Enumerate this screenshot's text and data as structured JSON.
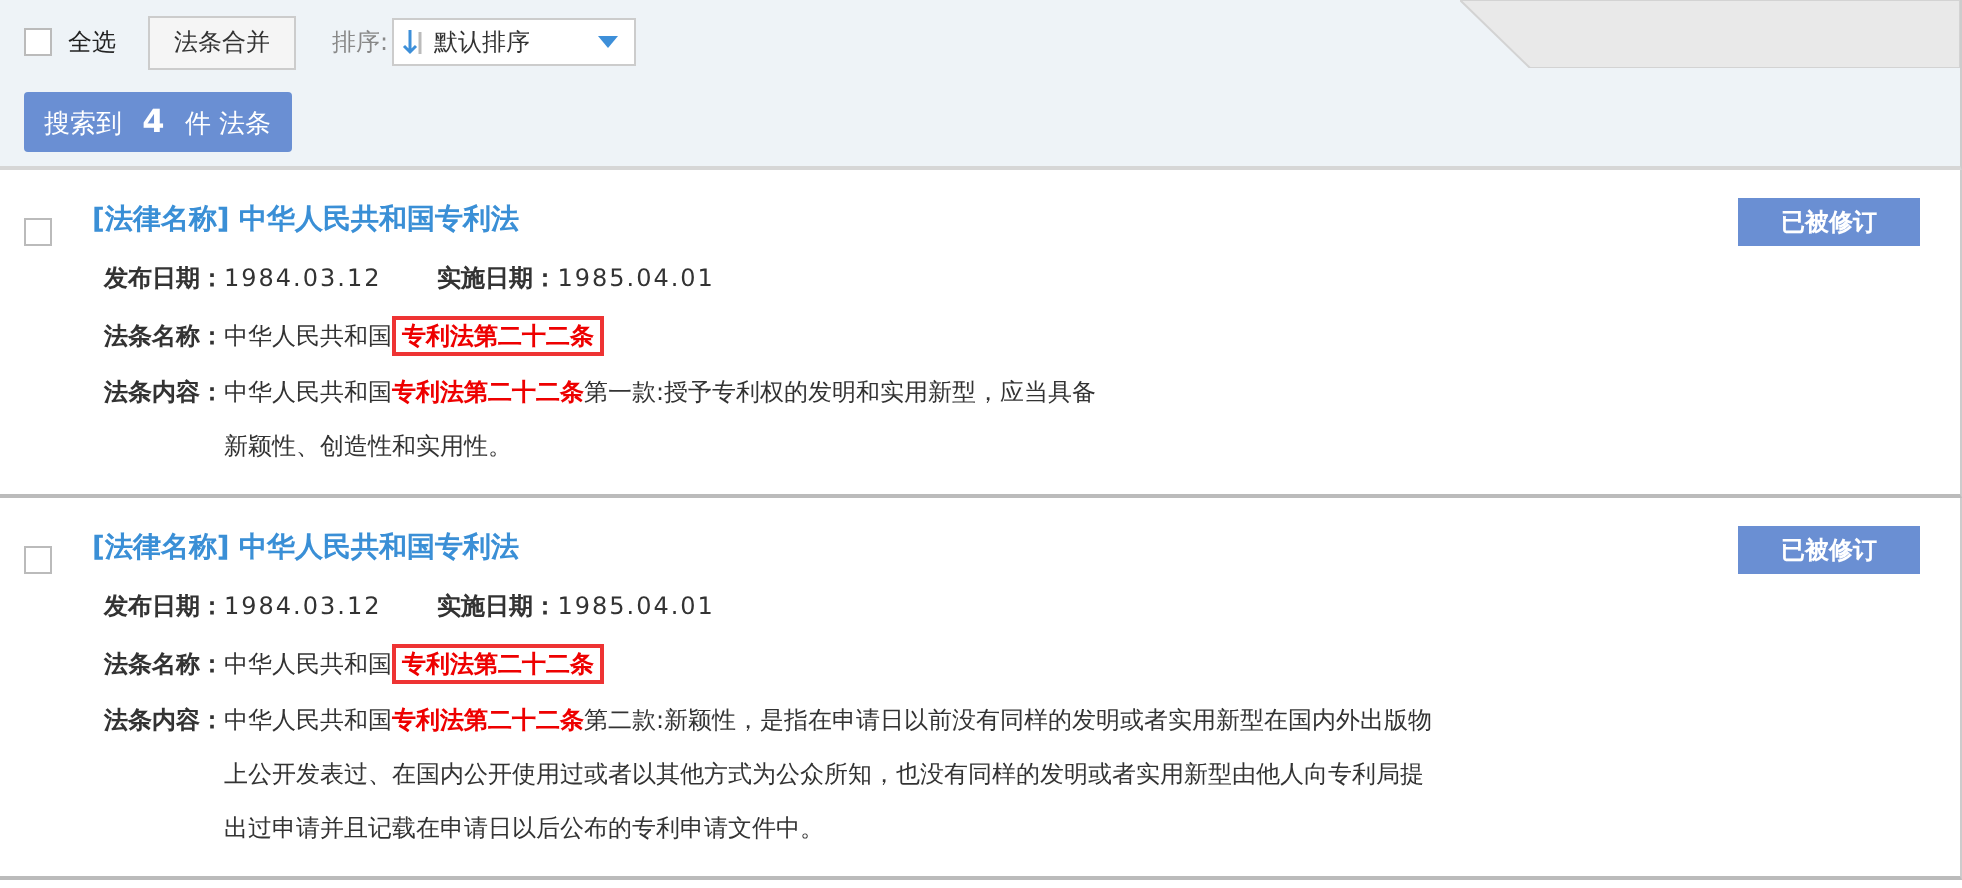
{
  "toolbar": {
    "select_all": {
      "label": "全选",
      "checked": false
    },
    "merge_button": "法条合并",
    "sort": {
      "label": "排序:",
      "value": "默认排序"
    }
  },
  "result_count": "搜索到 **4** 件 法条",
  "results": [
    {
      "checked": false,
      "title": "[法律名称] 中华人民共和国专利法",
      "status_button": "已被修订",
      "publish_label": "发布日期：",
      "publish_date": "1984.03.12",
      "effective_label": "实施日期：",
      "effective_date": "1985.04.01",
      "name_label": "法条名称：",
      "name": "中华人民共和国**专利法第二十二条**",
      "content_label": "法条内容：",
      "content_lines": [
        "中华人民共和国**专利法第二十二条**第一款:授予专利权的发明和实用新型，应当具备",
        "新颖性、创造性和实用性。"
      ]
    },
    {
      "checked": false,
      "title": "[法律名称] 中华人民共和国专利法",
      "status_button": "已被修订",
      "publish_label": "发布日期：",
      "publish_date": "1984.03.12",
      "effective_label": "实施日期：",
      "effective_date": "1985.04.01",
      "name_label": "法条名称：",
      "name": "中华人民共和国**专利法第二十二条**",
      "content_label": "法条内容：",
      "content_lines": [
        "中华人民共和国**专利法第二十二条**第二款:新颖性，是指在申请日以前没有同样的发明或者实用新型在国内外出版物",
        "上公开发表过、在国内公开使用过或者以其他方式为公众所知，也没有同样的发明或者实用新型由他人向专利局提",
        "出过申请并且记载在申请日以后公布的专利申请文件中。"
      ]
    }
  ]
}
